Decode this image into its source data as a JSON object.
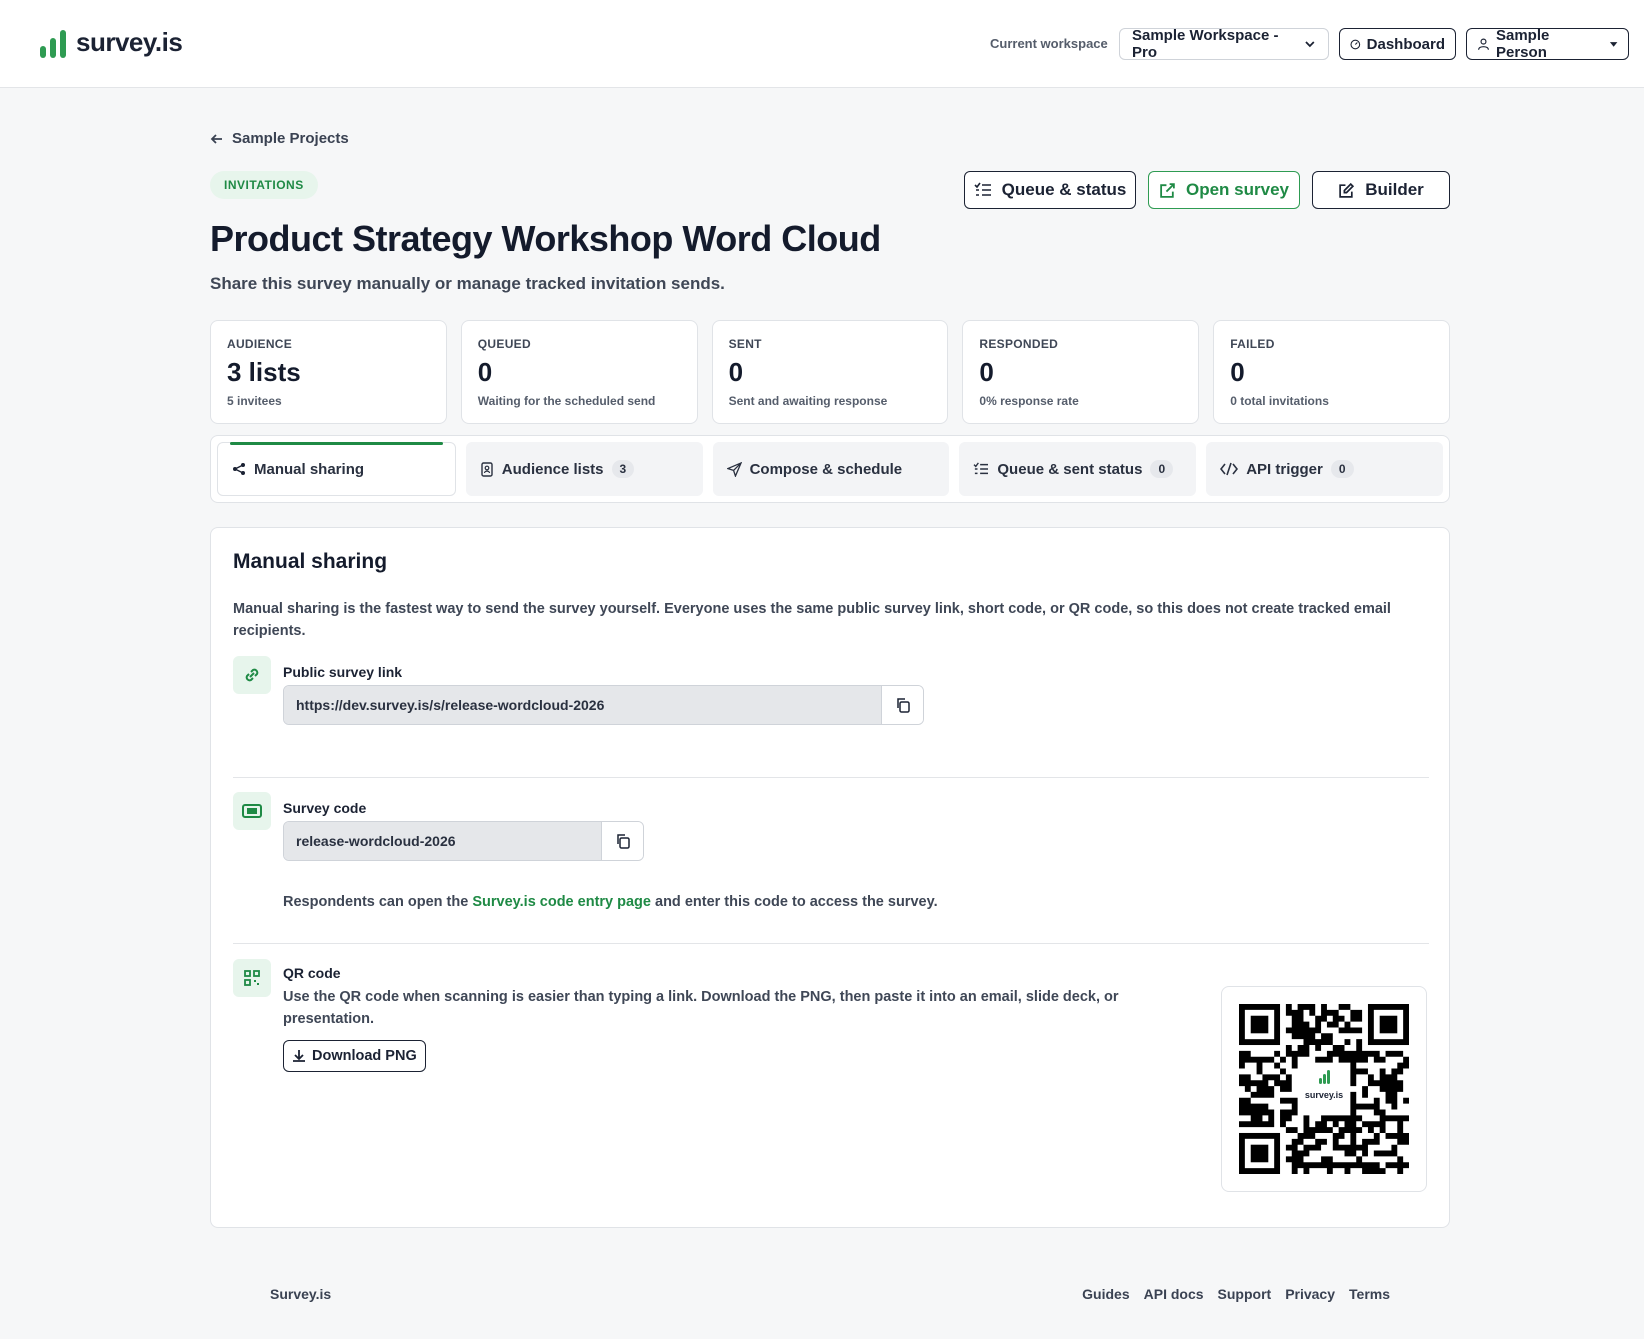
{
  "brand": {
    "name": "survey.is",
    "accent": "#2e9b52"
  },
  "topbar": {
    "workspace_label": "Current workspace",
    "workspace_value": "Sample Workspace - Pro",
    "dashboard_label": "Dashboard",
    "user_label": "Sample Person"
  },
  "back": {
    "label": "Sample Projects"
  },
  "header": {
    "pill": "INVITATIONS",
    "title": "Product Strategy Workshop Word Cloud",
    "subtitle": "Share this survey manually or manage tracked invitation sends.",
    "queue_btn": "Queue & status",
    "open_btn": "Open survey",
    "builder_btn": "Builder"
  },
  "stats": [
    {
      "label": "AUDIENCE",
      "value": "3 lists",
      "sub": "5 invitees"
    },
    {
      "label": "QUEUED",
      "value": "0",
      "sub": "Waiting for the scheduled send"
    },
    {
      "label": "SENT",
      "value": "0",
      "sub": "Sent and awaiting response"
    },
    {
      "label": "RESPONDED",
      "value": "0",
      "sub": "0% response rate"
    },
    {
      "label": "FAILED",
      "value": "0",
      "sub": "0 total invitations"
    }
  ],
  "tabs": [
    {
      "label": "Manual sharing",
      "icon": "share-icon"
    },
    {
      "label": "Audience lists",
      "icon": "contacts-icon",
      "count": "3"
    },
    {
      "label": "Compose & schedule",
      "icon": "send-icon"
    },
    {
      "label": "Queue & sent status",
      "icon": "list-icon",
      "count": "0"
    },
    {
      "label": "API trigger",
      "icon": "code-icon",
      "count": "0"
    }
  ],
  "manual": {
    "title": "Manual sharing",
    "description": "Manual sharing is the fastest way to send the survey yourself. Everyone uses the same public survey link, short code, or QR code, so this does not create tracked email recipients.",
    "link_label": "Public survey link",
    "link_value": "https://dev.survey.is/s/release-wordcloud-2026",
    "code_label": "Survey code",
    "code_value": "release-wordcloud-2026",
    "code_help_pre": "Respondents can open the ",
    "code_help_link": "Survey.is code entry page",
    "code_help_post": " and enter this code to access the survey.",
    "qr_label": "QR code",
    "qr_desc": "Use the QR code when scanning is easier than typing a link. Download the PNG, then paste it into an email, slide deck, or presentation.",
    "download_btn": "Download PNG",
    "qr_logo_text": "survey.is"
  },
  "footer": {
    "brand": "Survey.is",
    "links": [
      "Guides",
      "API docs",
      "Support",
      "Privacy",
      "Terms"
    ]
  }
}
